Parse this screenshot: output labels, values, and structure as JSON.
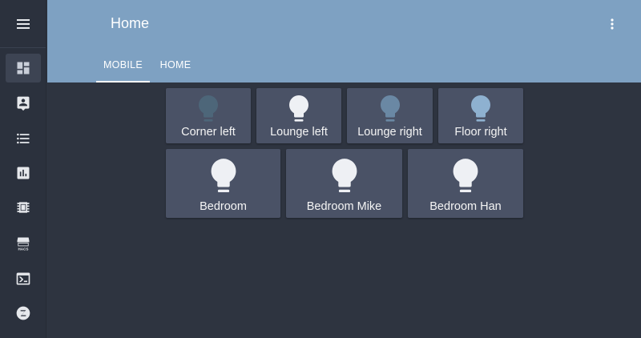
{
  "header": {
    "title": "Home",
    "tabs": [
      {
        "label": "MOBILE",
        "active": true
      },
      {
        "label": "HOME",
        "active": false
      }
    ]
  },
  "sidebar": {
    "items": [
      {
        "icon": "dashboard-icon",
        "active": true
      },
      {
        "icon": "logbook-icon"
      },
      {
        "icon": "list-icon"
      },
      {
        "icon": "history-icon"
      },
      {
        "icon": "device-icon"
      },
      {
        "icon": "hacs-icon"
      },
      {
        "icon": "terminal-icon"
      },
      {
        "icon": "zwave-icon"
      }
    ]
  },
  "lights": [
    {
      "name": "Corner left",
      "state": "unavailable",
      "color": "#4d6679"
    },
    {
      "name": "Lounge left",
      "state": "on",
      "color": "#eef0f4"
    },
    {
      "name": "Lounge right",
      "state": "off",
      "color": "#6a88a4"
    },
    {
      "name": "Floor right",
      "state": "dim",
      "color": "#8eb1d0"
    },
    {
      "name": "Bedroom",
      "state": "on",
      "color": "#eef0f4"
    },
    {
      "name": "Bedroom Mike",
      "state": "on",
      "color": "#eef0f4"
    },
    {
      "name": "Bedroom Han",
      "state": "on",
      "color": "#eef0f4"
    }
  ]
}
